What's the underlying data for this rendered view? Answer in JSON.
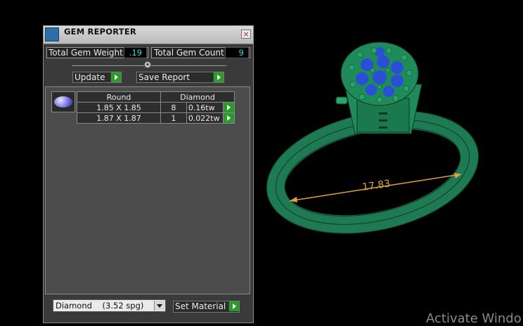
{
  "panel": {
    "title": "GEM REPORTER",
    "close_label": "×",
    "total_gem_weight_label": "Total Gem Weight",
    "total_gem_weight_value": ".19",
    "total_gem_count_label": "Total Gem Count",
    "total_gem_count_value": "9",
    "update_label": "Update",
    "save_report_label": "Save Report",
    "table": {
      "headers": [
        "Round",
        "Diamond"
      ],
      "rows": [
        {
          "size": "1.85 X 1.85",
          "count": "8",
          "weight": "0.16tw"
        },
        {
          "size": "1.87 X 1.87",
          "count": "1",
          "weight": "0.022tw"
        }
      ]
    },
    "material_select_value": "Diamond    (3.52 spg)",
    "set_material_label": "Set Material"
  },
  "viewport": {
    "dimension_label": "17.83",
    "ring_color": "#1f8a5a",
    "stone_color": "#2a4fd6"
  },
  "watermark": "Activate Windo"
}
